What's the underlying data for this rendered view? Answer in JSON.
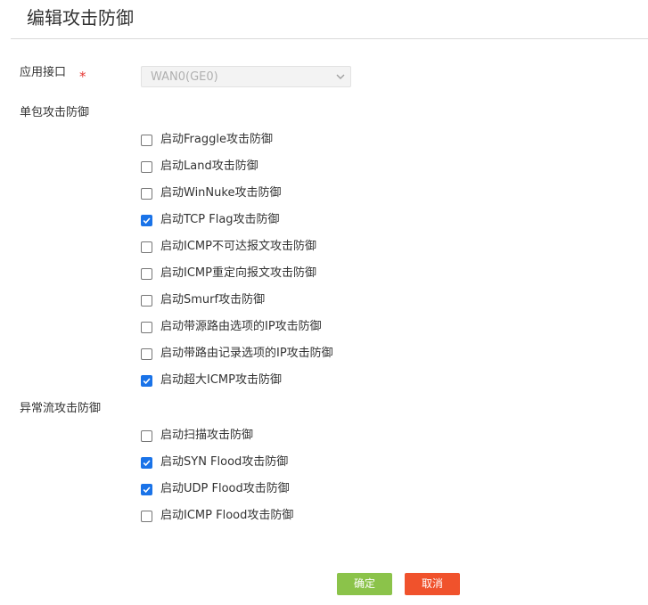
{
  "header": {
    "title": "编辑攻击防御"
  },
  "interface": {
    "label": "应用接口",
    "required_mark": "*",
    "selected": "WAN0(GE0)",
    "disabled": true
  },
  "single_packet": {
    "label": "单包攻击防御",
    "items": [
      {
        "label": "启动Fraggle攻击防御",
        "checked": false
      },
      {
        "label": "启动Land攻击防御",
        "checked": false
      },
      {
        "label": "启动WinNuke攻击防御",
        "checked": false
      },
      {
        "label": "启动TCP Flag攻击防御",
        "checked": true
      },
      {
        "label": "启动ICMP不可达报文攻击防御",
        "checked": false
      },
      {
        "label": "启动ICMP重定向报文攻击防御",
        "checked": false
      },
      {
        "label": "启动Smurf攻击防御",
        "checked": false
      },
      {
        "label": "启动带源路由选项的IP攻击防御",
        "checked": false
      },
      {
        "label": "启动带路由记录选项的IP攻击防御",
        "checked": false
      },
      {
        "label": "启动超大ICMP攻击防御",
        "checked": true
      }
    ]
  },
  "abnormal_flow": {
    "label": "异常流攻击防御",
    "items": [
      {
        "label": "启动扫描攻击防御",
        "checked": false
      },
      {
        "label": "启动SYN Flood攻击防御",
        "checked": true
      },
      {
        "label": "启动UDP Flood攻击防御",
        "checked": true
      },
      {
        "label": "启动ICMP Flood攻击防御",
        "checked": false
      }
    ]
  },
  "buttons": {
    "ok_label": "确定",
    "cancel_label": "取消"
  },
  "colors": {
    "checkbox_checked": "#1a73e8",
    "ok_button": "#8bc34a",
    "cancel_button": "#f0522c",
    "required_mark": "#e53935"
  }
}
